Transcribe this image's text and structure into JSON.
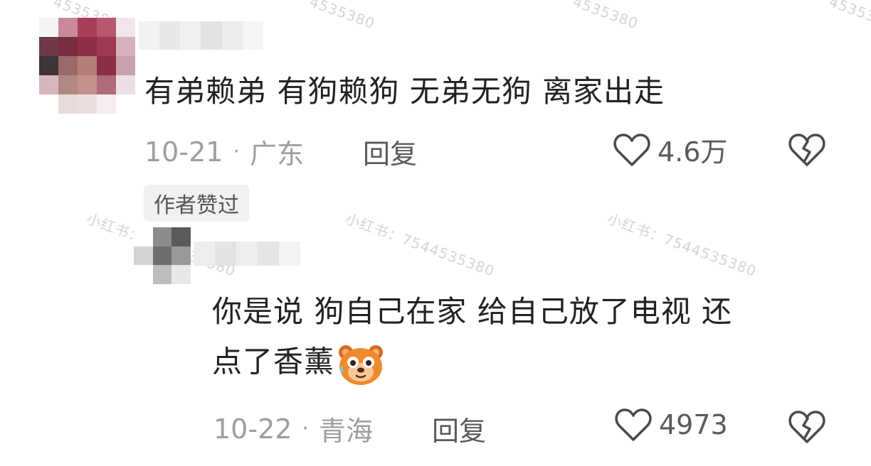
{
  "watermark": {
    "text": "小红书：7544535380",
    "partial": "4535380"
  },
  "comments": [
    {
      "text": "有弟赖弟 有狗赖狗 无弟无狗 离家出走",
      "date": "10-21",
      "separator": "·",
      "location": "广东",
      "reply_label": "回复",
      "likes": "4.6万"
    },
    {
      "author_badge": "作者赞过",
      "text_line1": "你是说 狗自己在家 给自己放了电视 还",
      "text_line2": "点了香薰",
      "emoji": "bear-sweat-emoji",
      "date": "10-22",
      "separator": "·",
      "location": "青海",
      "reply_label": "回复",
      "likes": "4973"
    }
  ],
  "colors": {
    "text": "#222222",
    "meta": "#9e9e9e",
    "action": "#5a5a5a",
    "icon": "#4a4a4a",
    "badge_bg": "#f1f1f1"
  },
  "icons": [
    "heart-outline-icon",
    "broken-heart-icon"
  ]
}
